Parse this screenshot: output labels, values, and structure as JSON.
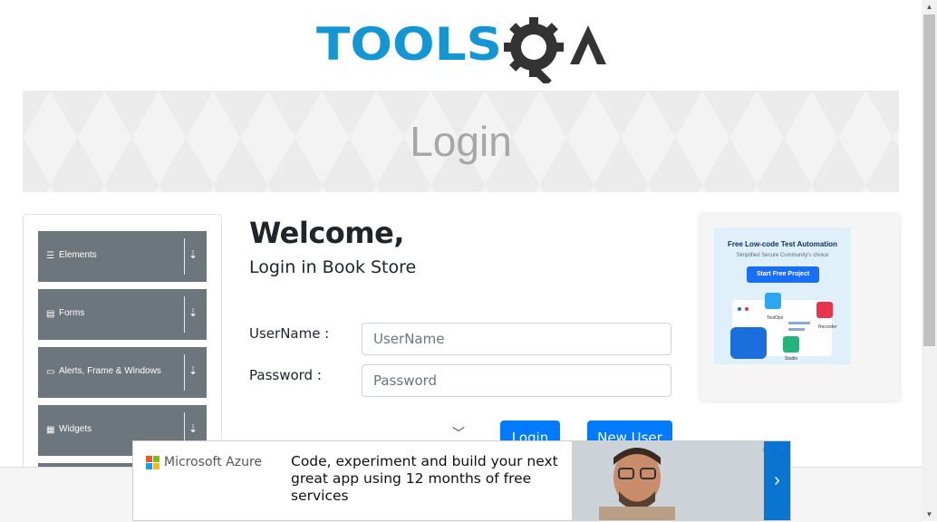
{
  "logo": {
    "text": "TOOLSQA"
  },
  "banner": {
    "title": "Login"
  },
  "sidebar": {
    "groups": [
      {
        "label": "Elements",
        "icon": "list-icon"
      },
      {
        "label": "Forms",
        "icon": "form-icon"
      },
      {
        "label": "Alerts, Frame & Windows",
        "icon": "window-icon"
      },
      {
        "label": "Widgets",
        "icon": "grid-icon"
      }
    ],
    "expand_icon": "⇣"
  },
  "login": {
    "heading": "Welcome,",
    "subheading": "Login in Book Store",
    "username_label": "UserName :",
    "username_placeholder": "UserName",
    "password_label": "Password :",
    "password_placeholder": "Password",
    "login_button": "Login",
    "new_user_button": "New User"
  },
  "promo": {
    "title": "Free Low-code Test Automation",
    "tagline": "Simplified Secure Community's choice",
    "cta": "Start Free Project",
    "labels": [
      "TestOps",
      "Recorder",
      "Studio"
    ]
  },
  "ad": {
    "brand": "Microsoft Azure",
    "text": "Code, experiment and build your next great app using 12 months of free services",
    "next_icon": "›"
  },
  "colors": {
    "accent": "#007bff",
    "sidebar": "#6d757d",
    "logo_blue": "#1296d4",
    "logo_dark": "#333333"
  }
}
